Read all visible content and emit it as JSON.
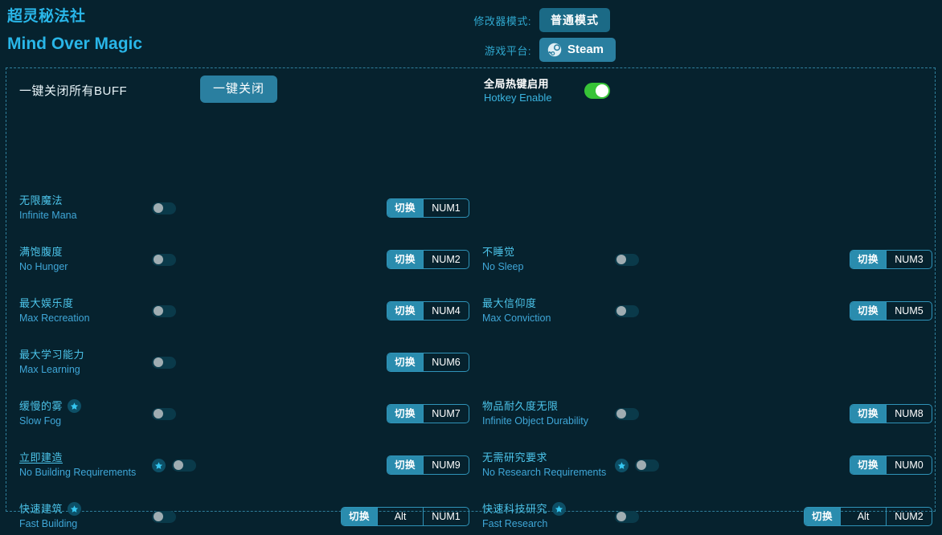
{
  "header": {
    "title_cn": "超灵秘法社",
    "title_en": "Mind Over Magic",
    "mode_label": "修改器模式:",
    "mode_value": "普通模式",
    "platform_label": "游戏平台:",
    "platform_value": "Steam",
    "platform_icon": "steam-icon"
  },
  "topbar": {
    "onekey_label": "一键关闭所有BUFF",
    "onekey_button": "一键关闭",
    "hotkey_enable_cn": "全局热键启用",
    "hotkey_enable_en": "Hotkey Enable",
    "hotkey_enable_state": "on"
  },
  "colors": {
    "background": "#06222e",
    "accent": "#2a8cae",
    "cyan": "#4cc4ea",
    "toggle_on": "#37c337",
    "toggle_off": "#0a3a4a",
    "border_dashed": "#2f7f9b"
  },
  "left_column": [
    {
      "name_cn": "无限魔法",
      "name_en": "Infinite Mana",
      "star": false,
      "star_inline": false,
      "underline": false,
      "toggle": "off",
      "hotkey": {
        "action": "切换",
        "keys": [
          "NUM1"
        ]
      }
    },
    {
      "name_cn": "满饱腹度",
      "name_en": "No Hunger",
      "star": false,
      "star_inline": false,
      "underline": false,
      "toggle": "off",
      "hotkey": {
        "action": "切换",
        "keys": [
          "NUM2"
        ]
      }
    },
    {
      "name_cn": "最大娱乐度",
      "name_en": "Max Recreation",
      "star": false,
      "star_inline": false,
      "underline": false,
      "toggle": "off",
      "hotkey": {
        "action": "切换",
        "keys": [
          "NUM4"
        ]
      }
    },
    {
      "name_cn": "最大学习能力",
      "name_en": "Max Learning",
      "star": false,
      "star_inline": false,
      "underline": false,
      "toggle": "off",
      "hotkey": {
        "action": "切换",
        "keys": [
          "NUM6"
        ]
      }
    },
    {
      "name_cn": "缓慢的雾",
      "name_en": "Slow Fog",
      "star": true,
      "star_inline": true,
      "underline": false,
      "toggle": "off",
      "hotkey": {
        "action": "切换",
        "keys": [
          "NUM7"
        ]
      }
    },
    {
      "name_cn": "立即建造",
      "name_en": "No Building Requirements",
      "star": true,
      "star_inline": false,
      "underline": true,
      "toggle": "off",
      "hotkey": {
        "action": "切换",
        "keys": [
          "NUM9"
        ]
      }
    },
    {
      "name_cn": "快速建筑",
      "name_en": "Fast Building",
      "star": true,
      "star_inline": true,
      "underline": false,
      "toggle": "off",
      "hotkey": {
        "action": "切换",
        "keys": [
          "Alt",
          "NUM1"
        ]
      }
    }
  ],
  "right_column": [
    {
      "name_cn": "不睡觉",
      "name_en": "No Sleep",
      "star": false,
      "star_inline": false,
      "underline": false,
      "toggle": "off",
      "hotkey": {
        "action": "切换",
        "keys": [
          "NUM3"
        ]
      }
    },
    {
      "name_cn": "最大信仰度",
      "name_en": "Max Conviction",
      "star": false,
      "star_inline": false,
      "underline": false,
      "toggle": "off",
      "hotkey": {
        "action": "切换",
        "keys": [
          "NUM5"
        ]
      }
    },
    {
      "name_cn": "物品耐久度无限",
      "name_en": "Infinite Object Durability",
      "star": false,
      "star_inline": false,
      "underline": false,
      "toggle": "off",
      "hotkey": {
        "action": "切换",
        "keys": [
          "NUM8"
        ]
      }
    },
    {
      "name_cn": "无需研究要求",
      "name_en": "No Research Requirements",
      "star": true,
      "star_inline": false,
      "underline": false,
      "toggle": "off",
      "hotkey": {
        "action": "切换",
        "keys": [
          "NUM0"
        ]
      }
    },
    {
      "name_cn": "快速科技研究",
      "name_en": "Fast Research",
      "star": true,
      "star_inline": true,
      "underline": false,
      "toggle": "off",
      "hotkey": {
        "action": "切换",
        "keys": [
          "Alt",
          "NUM2"
        ]
      }
    }
  ],
  "layout": {
    "left_row_tops": [
      89,
      153,
      217,
      281,
      345,
      409,
      473
    ],
    "right_row_tops": [
      153,
      217,
      345,
      409,
      473
    ]
  }
}
